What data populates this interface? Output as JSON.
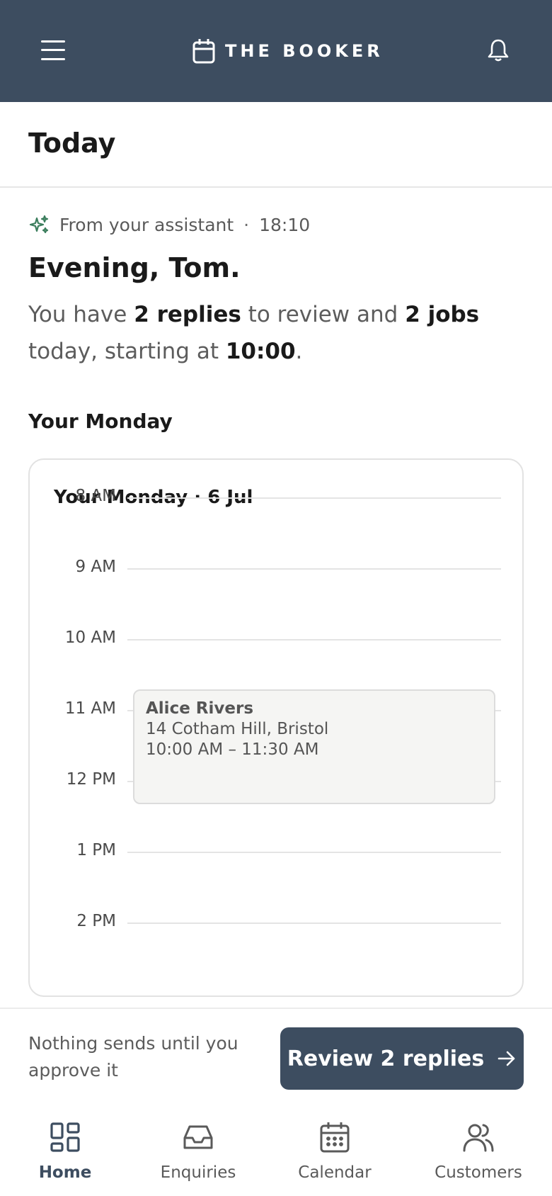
{
  "header": {
    "app_title": "THE BOOKER",
    "icons": {
      "menu": "menu-icon",
      "brand": "calendar-icon",
      "notifications": "bell-icon"
    },
    "background": "#3d4d60"
  },
  "page": {
    "title": "Today"
  },
  "assistant": {
    "source_label": "From your assistant",
    "separator": "·",
    "time": "18:10",
    "icon": "sparkle-icon",
    "accent": "#3a7d5c",
    "greeting": "Evening, Tom.",
    "summary": {
      "part1": "You have ",
      "replies": "2 replies",
      "part2": " to review and ",
      "jobs": "2 jobs",
      "part3": " today, starting at ",
      "start_time": "10:00",
      "part4": "."
    }
  },
  "day_section": {
    "heading": "Your Monday"
  },
  "day_card": {
    "title": "Your Monday · 6 Jul",
    "hours": [
      "8 AM",
      "9 AM",
      "10 AM",
      "11 AM",
      "12 PM",
      "1 PM",
      "2 PM"
    ],
    "events": [
      {
        "name": "Alice Rivers",
        "address": "14 Cotham Hill, Bristol",
        "time": "10:00 AM – 11:30 AM"
      }
    ]
  },
  "action_bar": {
    "note": "Nothing sends until you approve it",
    "review_label": "Review 2 replies",
    "review_icon": "arrow-right-icon"
  },
  "bottom_nav": {
    "items": [
      {
        "label": "Home",
        "icon": "grid-icon",
        "active": true
      },
      {
        "label": "Enquiries",
        "icon": "inbox-icon",
        "active": false
      },
      {
        "label": "Calendar",
        "icon": "calendar-icon",
        "active": false
      },
      {
        "label": "Customers",
        "icon": "users-icon",
        "active": false
      }
    ]
  }
}
